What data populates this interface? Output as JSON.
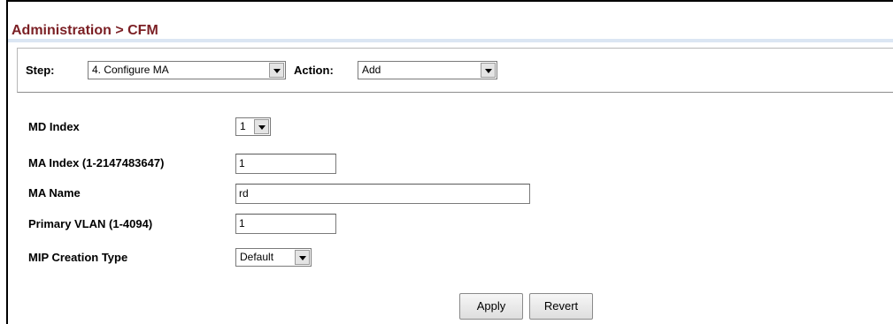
{
  "header": {
    "title": "Administration > CFM"
  },
  "step_bar": {
    "step_label": "Step:",
    "step_value": "4. Configure MA",
    "action_label": "Action:",
    "action_value": "Add"
  },
  "form": {
    "md_index": {
      "label": "MD Index",
      "value": "1"
    },
    "ma_index": {
      "label": "MA Index (1-2147483647)",
      "value": "1"
    },
    "ma_name": {
      "label": "MA Name",
      "value": "rd"
    },
    "primary_vlan": {
      "label": "Primary VLAN (1-4094)",
      "value": "1"
    },
    "mip_creation_type": {
      "label": "MIP Creation Type",
      "value": "Default"
    }
  },
  "buttons": {
    "apply": "Apply",
    "revert": "Revert"
  },
  "icons": {
    "dropdown": "chevron-down-icon"
  }
}
